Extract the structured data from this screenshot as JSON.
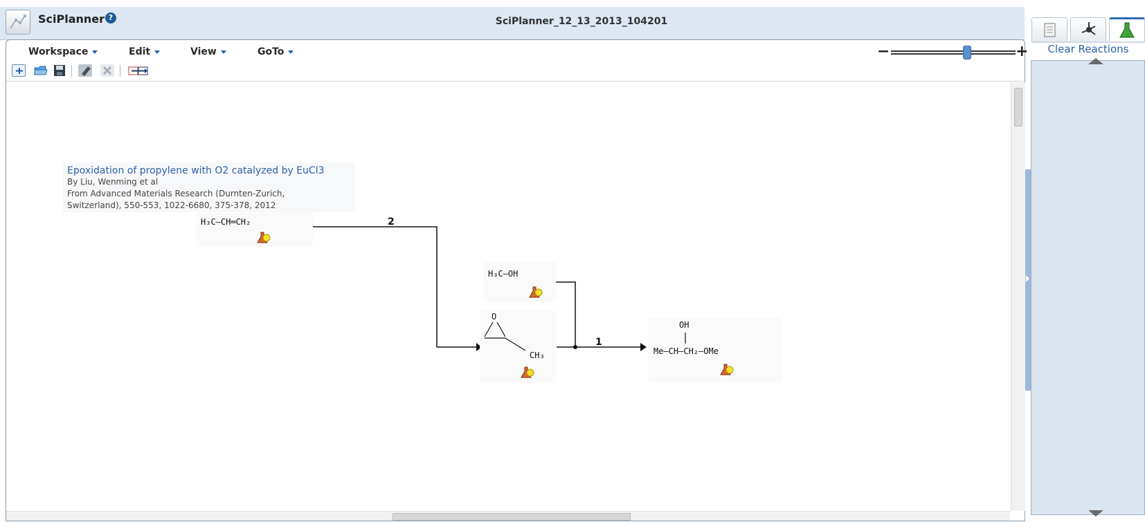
{
  "app": {
    "name": "SciPlanner",
    "document_title": "SciPlanner_12_13_2013_104201"
  },
  "menus": [
    {
      "label": "Workspace"
    },
    {
      "label": "Edit"
    },
    {
      "label": "View"
    },
    {
      "label": "GoTo"
    }
  ],
  "toolbar": {
    "icons": [
      "new-icon",
      "open-folder-icon",
      "save-icon",
      "edit-icon",
      "delete-icon",
      "export-icon"
    ]
  },
  "zoom": {
    "minus": "−",
    "plus": "+",
    "level": 0.62
  },
  "reference": {
    "title": "Epoxidation of propylene with O2 catalyzed by EuCl3",
    "authors": "By Liu, Wenming et al",
    "source_line1": "From Advanced Materials Research (Durnten-Zurich,",
    "source_line2": "Switzerland), 550-553, 1022-6680, 375-378, 2012"
  },
  "reaction": {
    "molecules": {
      "propylene": {
        "formula": "H₃C—CH═CH₂"
      },
      "methanol": {
        "formula": "H₃C—OH"
      },
      "epoxide": {
        "o_label": "O",
        "substituent": "CH₃"
      },
      "product": {
        "oh_label": "OH",
        "chain": "Me—CH—CH₂—OMe"
      }
    },
    "steps": [
      {
        "number": "2"
      },
      {
        "number": "1"
      }
    ]
  },
  "side_panel": {
    "tabs": [
      "document-tab-icon",
      "molecule-tab-icon",
      "flask-tab-icon"
    ],
    "clear_reactions_label": "Clear Reactions"
  },
  "colors": {
    "header_bg": "#dde8f3",
    "accent": "#2b62a8",
    "side_panel_bg": "#dce6f1"
  }
}
